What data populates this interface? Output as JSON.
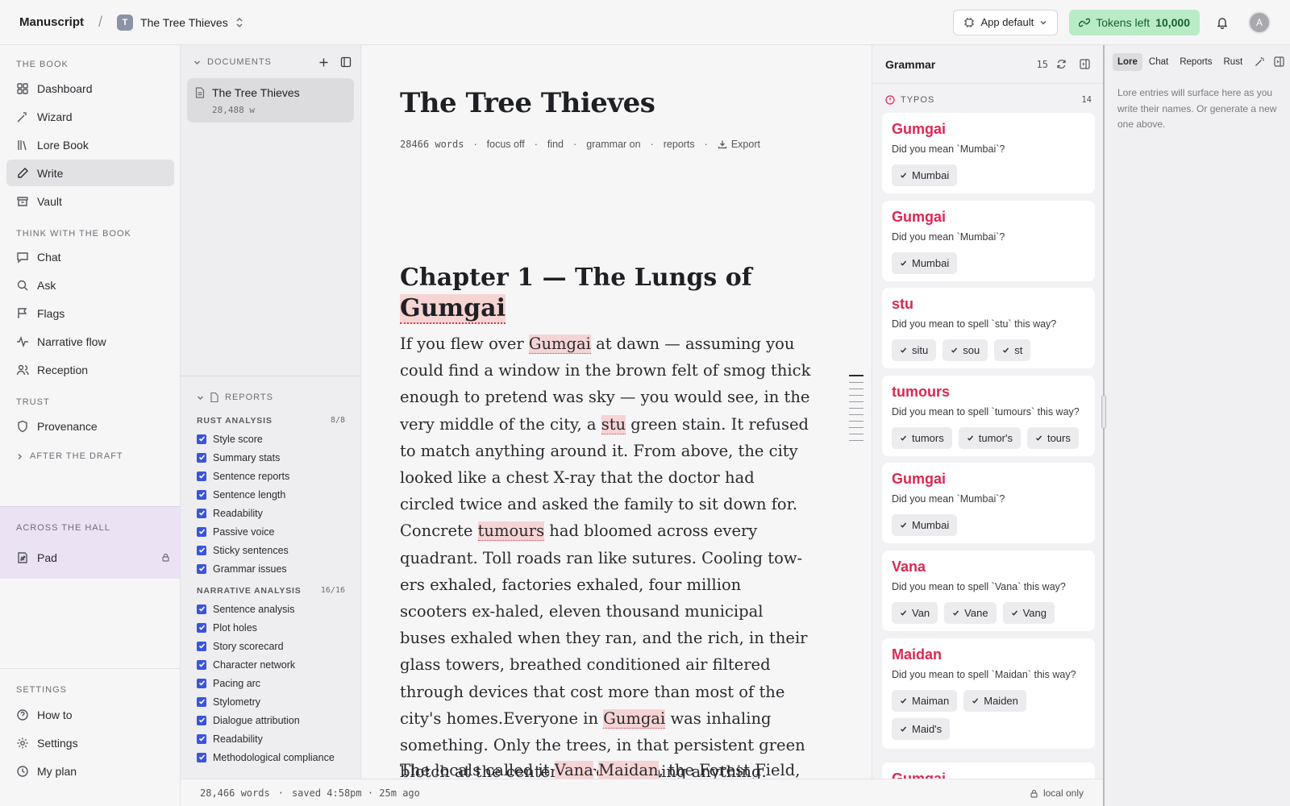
{
  "topbar": {
    "brand": "Manuscript",
    "separator": "/",
    "project_initial": "T",
    "project_name": "The Tree Thieves",
    "model_select": "App default",
    "tokens_label": "Tokens left",
    "tokens_value": "10,000",
    "avatar_initial": "A"
  },
  "sidebar": {
    "book_label": "THE BOOK",
    "book_items": [
      {
        "label": "Dashboard",
        "icon": "dashboard-icon"
      },
      {
        "label": "Wizard",
        "icon": "wand-icon"
      },
      {
        "label": "Lore Book",
        "icon": "library-icon"
      },
      {
        "label": "Write",
        "icon": "pen-icon",
        "active": true
      },
      {
        "label": "Vault",
        "icon": "archive-icon"
      }
    ],
    "think_label": "THINK WITH THE BOOK",
    "think_items": [
      {
        "label": "Chat",
        "icon": "chat-icon"
      },
      {
        "label": "Ask",
        "icon": "search-icon"
      },
      {
        "label": "Flags",
        "icon": "flag-icon"
      },
      {
        "label": "Narrative flow",
        "icon": "pulse-icon"
      },
      {
        "label": "Reception",
        "icon": "users-icon"
      }
    ],
    "trust_label": "TRUST",
    "trust_items": [
      {
        "label": "Provenance",
        "icon": "shield-icon"
      }
    ],
    "after_label": "AFTER THE DRAFT",
    "hall_label": "ACROSS THE HALL",
    "hall_item": "Pad",
    "settings_label": "SETTINGS",
    "settings_items": [
      {
        "label": "How to",
        "icon": "help-icon"
      },
      {
        "label": "Settings",
        "icon": "gear-icon"
      },
      {
        "label": "My plan",
        "icon": "clock-icon"
      }
    ]
  },
  "documents": {
    "header": "DOCUMENTS",
    "items": [
      {
        "title": "The Tree Thieves",
        "meta": "28,488 w"
      }
    ]
  },
  "reports": {
    "header": "REPORTS",
    "rust_label": "RUST ANALYSIS",
    "rust_count": "8/8",
    "rust_items": [
      "Style score",
      "Summary stats",
      "Sentence reports",
      "Sentence length",
      "Readability",
      "Passive voice",
      "Sticky sentences",
      "Grammar issues"
    ],
    "narr_label": "NARRATIVE ANALYSIS",
    "narr_count": "16/16",
    "narr_items": [
      "Sentence analysis",
      "Plot holes",
      "Story scorecard",
      "Character network",
      "Pacing arc",
      "Stylometry",
      "Dialogue attribution",
      "Readability",
      "Methodological compliance"
    ]
  },
  "editor": {
    "title": "The Tree Thieves",
    "meta": {
      "words": "28466 words",
      "focus": "focus off",
      "find": "find",
      "grammar": "grammar on",
      "reports": "reports",
      "export": "Export",
      "sep": "·"
    },
    "chapter_title_pre": "Chapter 1 — The Lungs of",
    "chapter_title_hl": "Gumgai",
    "p1": {
      "s1": "If you flew over ",
      "h1": "Gumgai",
      "s2": " at dawn — assuming you could find a window in the brown felt of smog thick enough to  pretend was sky — you would see, in the very middle of the city, a ",
      "h2": "stu",
      "s3": " green stain. It refused to match anything around it. From above, the city looked like a chest X-ray that the doctor had circled twice and asked the family to  sit down for. Concrete ",
      "h3": "tumours",
      "s4": " had bloomed across every quadrant. Toll roads ran like sutures. Cooling tow-ers exhaled, factories exhaled, four million scooters ex-haled, eleven thousand municipal buses exhaled when they ran, and the rich, in their glass towers, breathed conditioned air filtered through devices that cost more than most of the city's homes.Everyone in ",
      "h4": "Gumgai",
      "s5": " was inhaling something. Only the trees, in that persistent green blotch at the center, were returning anything."
    },
    "p2": {
      "s1": "The locals called it ",
      "h1": "Vana",
      "s2": " ",
      "h2": "Maidan",
      "s3": ", the Forest Field,"
    }
  },
  "grammar": {
    "title": "Grammar",
    "count": "15",
    "section_label": "TYPOS",
    "section_count": "14",
    "cards": [
      {
        "word": "Gumgai",
        "msg": "Did you mean `Mumbai`?",
        "suggestions": [
          "Mumbai"
        ]
      },
      {
        "word": "Gumgai",
        "msg": "Did you mean `Mumbai`?",
        "suggestions": [
          "Mumbai"
        ]
      },
      {
        "word": "stu",
        "msg": "Did you mean to spell `stu` this way?",
        "suggestions": [
          "situ",
          "sou",
          "st"
        ]
      },
      {
        "word": "tumours",
        "msg": "Did you mean to spell `tumours` this way?",
        "suggestions": [
          "tumors",
          "tumor's",
          "tours"
        ]
      },
      {
        "word": "Gumgai",
        "msg": "Did you mean `Mumbai`?",
        "suggestions": [
          "Mumbai"
        ]
      },
      {
        "word": "Vana",
        "msg": "Did you mean to spell `Vana` this way?",
        "suggestions": [
          "Van",
          "Vane",
          "Vang"
        ]
      },
      {
        "word": "Maidan",
        "msg": "Did you mean to spell `Maidan` this way?",
        "suggestions": [
          "Maiman",
          "Maiden",
          "Maid's"
        ]
      },
      {
        "word": "Gumgai",
        "msg": "",
        "suggestions": []
      }
    ]
  },
  "rightpanel": {
    "tabs": [
      "Lore",
      "Chat",
      "Reports",
      "Rust"
    ],
    "active_tab": "Lore",
    "lore_text": "Lore entries will surface here as you write their names. Or generate a new one above."
  },
  "status": {
    "words": "28,466 words",
    "sep": "·",
    "saved": "saved 4:58pm · 25m ago",
    "local": "local only"
  },
  "colors": {
    "accent": "#3b55d9",
    "typo_red": "#de2750",
    "token_green": "#b9ecc6",
    "hall_purple": "#ebe3f3"
  }
}
